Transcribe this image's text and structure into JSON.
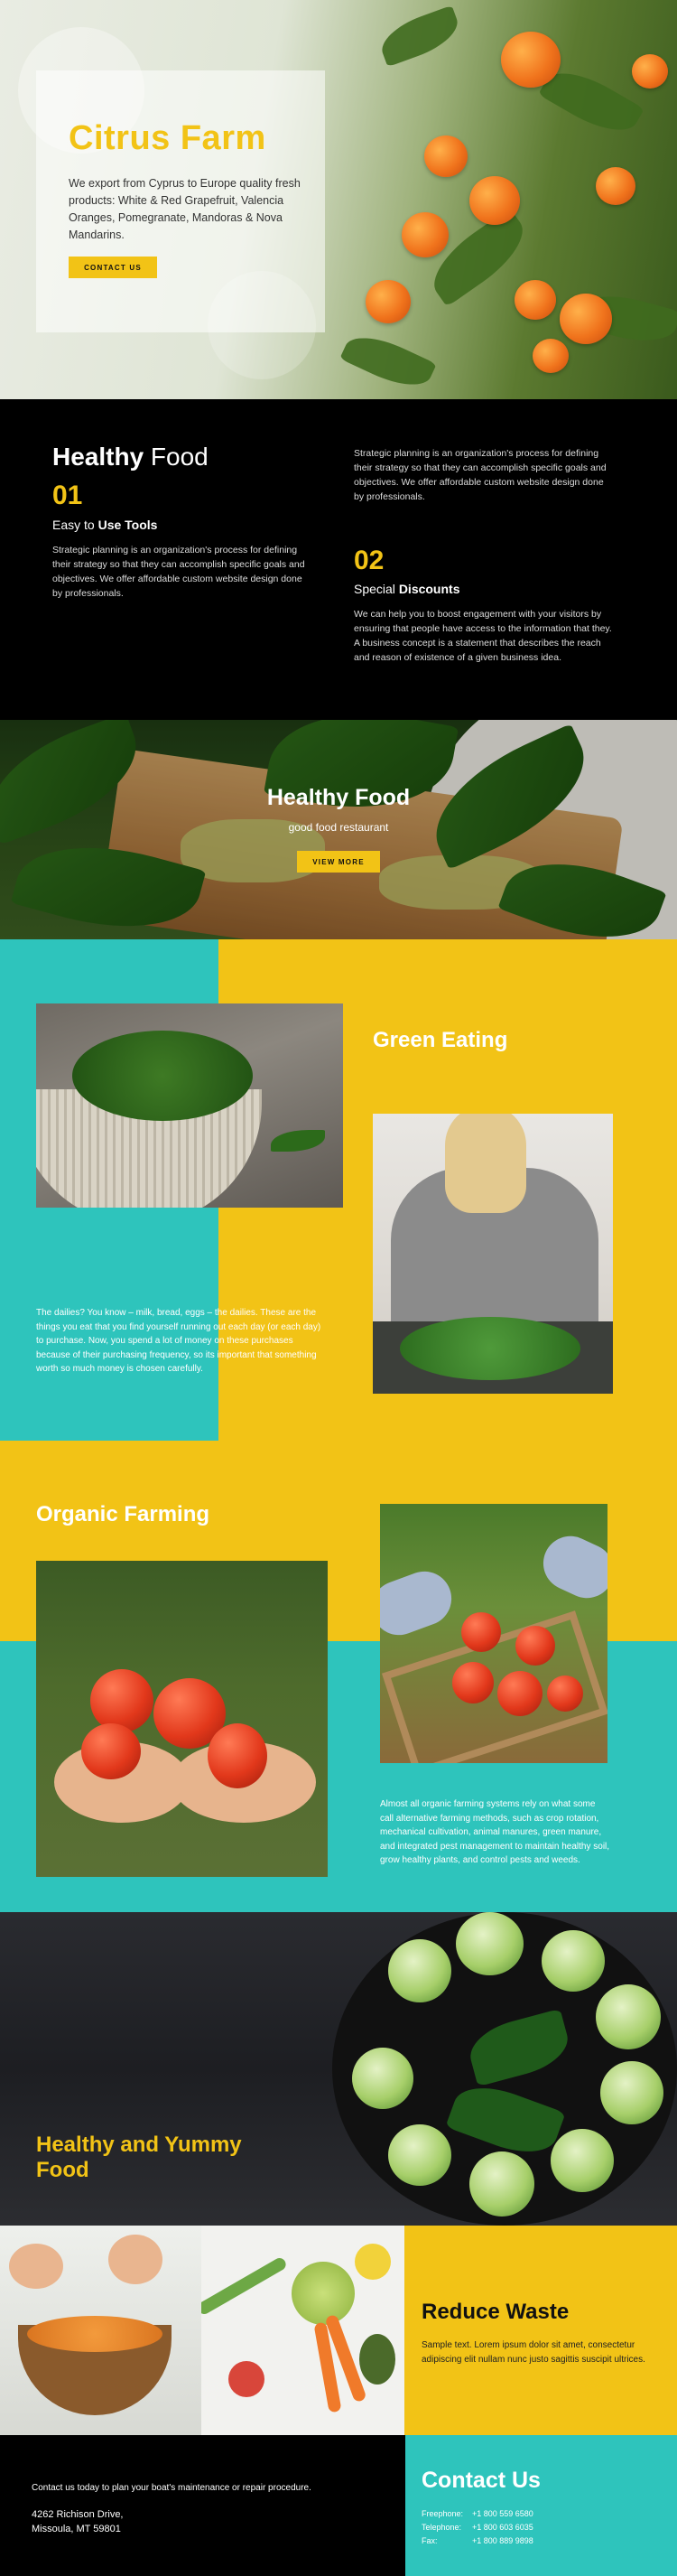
{
  "hero": {
    "title": "Citrus Farm",
    "description": "We export from Cyprus to Europe quality fresh products: White & Red Grapefruit, Valencia Oranges, Pomegranate, Mandoras & Nova Mandarins.",
    "button": "CONTACT US"
  },
  "healthy_food": {
    "title_bold": "Healthy",
    "title_rest": " Food",
    "item1": {
      "number": "01",
      "label_plain": "Easy to ",
      "label_bold": "Use Tools",
      "text": "Strategic planning is an organization's process for defining their strategy so that they can accomplish specific goals and objectives. We offer affordable custom website design done by professionals."
    },
    "right_top_text": "Strategic planning is an organization's process for defining their strategy so that they can accomplish specific goals and objectives. We offer affordable custom website design done by professionals.",
    "item2": {
      "number": "02",
      "label_plain": "Special ",
      "label_bold": "Discounts",
      "text": "We can help you to boost engagement with your visitors by ensuring that people have access to the information that they. A business concept is a statement that describes the reach and reason of existence of a given business idea."
    }
  },
  "banner": {
    "title": "Healthy Food",
    "tagline": "good food restaurant",
    "button": "VIEW MORE"
  },
  "green_eating": {
    "title": "Green Eating",
    "text": "The dailies? You know – milk, bread, eggs – the dailies. These are the things you eat that you find yourself running out each day (or each day) to purchase. Now, you spend a lot of money on these purchases because of their purchasing frequency, so its important that something worth so much money is chosen carefully."
  },
  "organic_farming": {
    "title": "Organic Farming",
    "text": "Almost all organic farming systems rely on what some call alternative farming methods, such as crop rotation, mechanical cultivation, animal manures, green manure, and integrated pest management to maintain healthy soil, grow healthy plants, and control pests and weeds."
  },
  "healthy_yummy": {
    "title": "Healthy and Yummy Food"
  },
  "reduce_waste": {
    "title": "Reduce Waste",
    "text": "Sample text. Lorem ipsum dolor sit amet, consectetur adipiscing elit nullam nunc justo sagittis suscipit ultrices."
  },
  "contact": {
    "plan_text": "Contact us today to plan your boat's maintenance or repair procedure.",
    "address_line1": "4262 Richison Drive,",
    "address_line2": "Missoula, MT 59801",
    "title": "Contact Us",
    "rows": [
      {
        "label": "Freephone:",
        "value": "+1 800 559 6580"
      },
      {
        "label": "Telephone:",
        "value": "+1 800 603 6035"
      },
      {
        "label": "Fax:",
        "value": "+1 800 889 9898"
      }
    ]
  },
  "colors": {
    "accent_yellow": "#f2c316",
    "teal": "#2ec4bc",
    "dark": "#000000"
  }
}
